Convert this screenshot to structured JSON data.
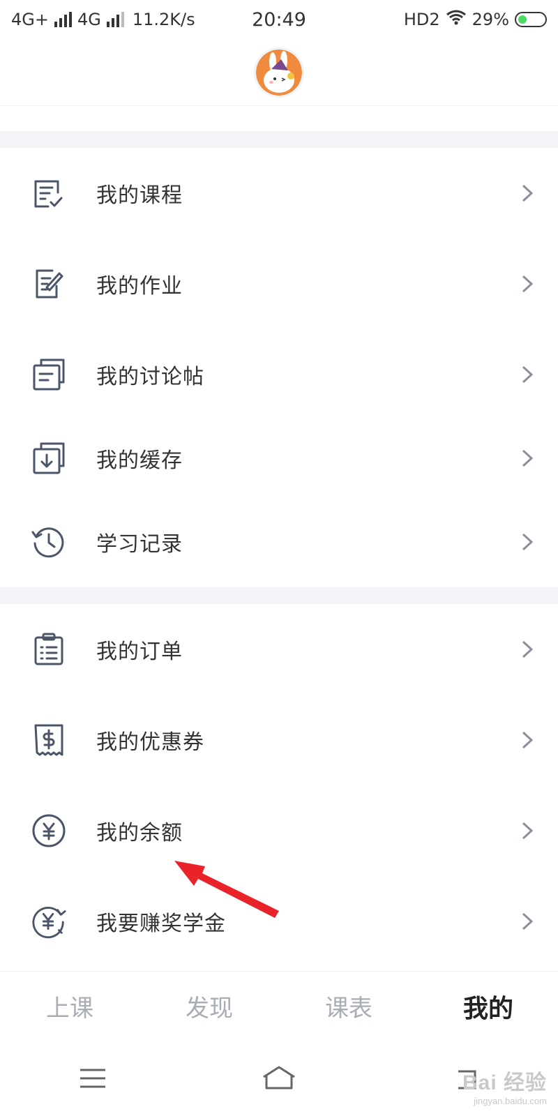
{
  "status_bar": {
    "network1": "4G+",
    "network2": "4G",
    "speed": "11.2K/s",
    "time": "20:49",
    "hd": "HD2",
    "battery": "29%"
  },
  "menu_group1": [
    {
      "label": "我的课程",
      "icon": "course-checklist-icon"
    },
    {
      "label": "我的作业",
      "icon": "homework-edit-icon"
    },
    {
      "label": "我的讨论帖",
      "icon": "discussion-post-icon"
    },
    {
      "label": "我的缓存",
      "icon": "download-cache-icon"
    },
    {
      "label": "学习记录",
      "icon": "history-clock-icon"
    }
  ],
  "menu_group2": [
    {
      "label": "我的订单",
      "icon": "order-clipboard-icon"
    },
    {
      "label": "我的优惠券",
      "icon": "coupon-dollar-icon"
    },
    {
      "label": "我的余额",
      "icon": "balance-yen-icon"
    },
    {
      "label": "我要赚奖学金",
      "icon": "scholarship-yen-icon"
    }
  ],
  "tabs": [
    {
      "label": "上课",
      "active": false
    },
    {
      "label": "发现",
      "active": false
    },
    {
      "label": "课表",
      "active": false
    },
    {
      "label": "我的",
      "active": true
    }
  ],
  "watermark": {
    "main": "Bai 经验",
    "sub": "jingyan.baidu.com"
  },
  "colors": {
    "accent_underline": "#c7d6f2",
    "icon": "#4a5568",
    "band": "#f4f5f8",
    "arrow": "#e8232a"
  }
}
